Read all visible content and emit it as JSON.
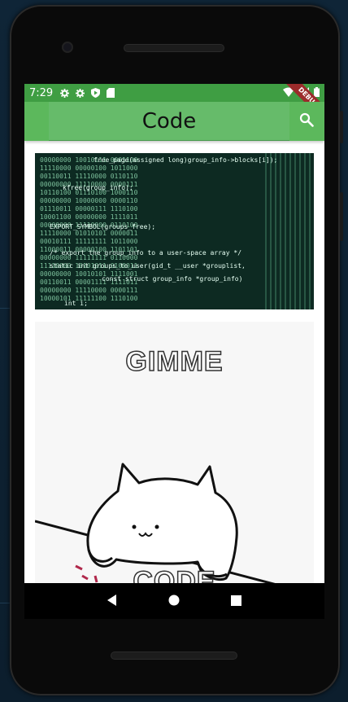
{
  "status_bar": {
    "time": "7:29",
    "left_icons": [
      "gear-icon",
      "gear-icon",
      "shield-icon",
      "sd-card-icon"
    ],
    "right_icons": [
      "wifi-icon",
      "signal-icon",
      "battery-icon"
    ],
    "debug_label": "DEBUG"
  },
  "app_bar": {
    "title": "Code",
    "action_icon": "search-icon"
  },
  "images": [
    {
      "name": "code-screen-image",
      "code_lines": [
        "free_page(assigned long)group_info->blocks[i]);",
        "kfree(group_info);",
        "EXPORT_SYMBOL(groups_free);",
        "/* export the group_info to a user-space array */",
        "static int groups_to_user(gid_t __user *grouplist,",
        "const struct group_info *group_info)",
        "int i;"
      ]
    },
    {
      "name": "bongo-cat-meme",
      "top_text": "GIMME",
      "bottom_text": "CODE"
    }
  ],
  "nav_bar": {
    "buttons": [
      "back-icon",
      "home-icon",
      "recents-icon"
    ]
  },
  "colors": {
    "status_bar": "#3f9e43",
    "app_bar": "#5cb85c",
    "title_box": "#66bb6a"
  }
}
